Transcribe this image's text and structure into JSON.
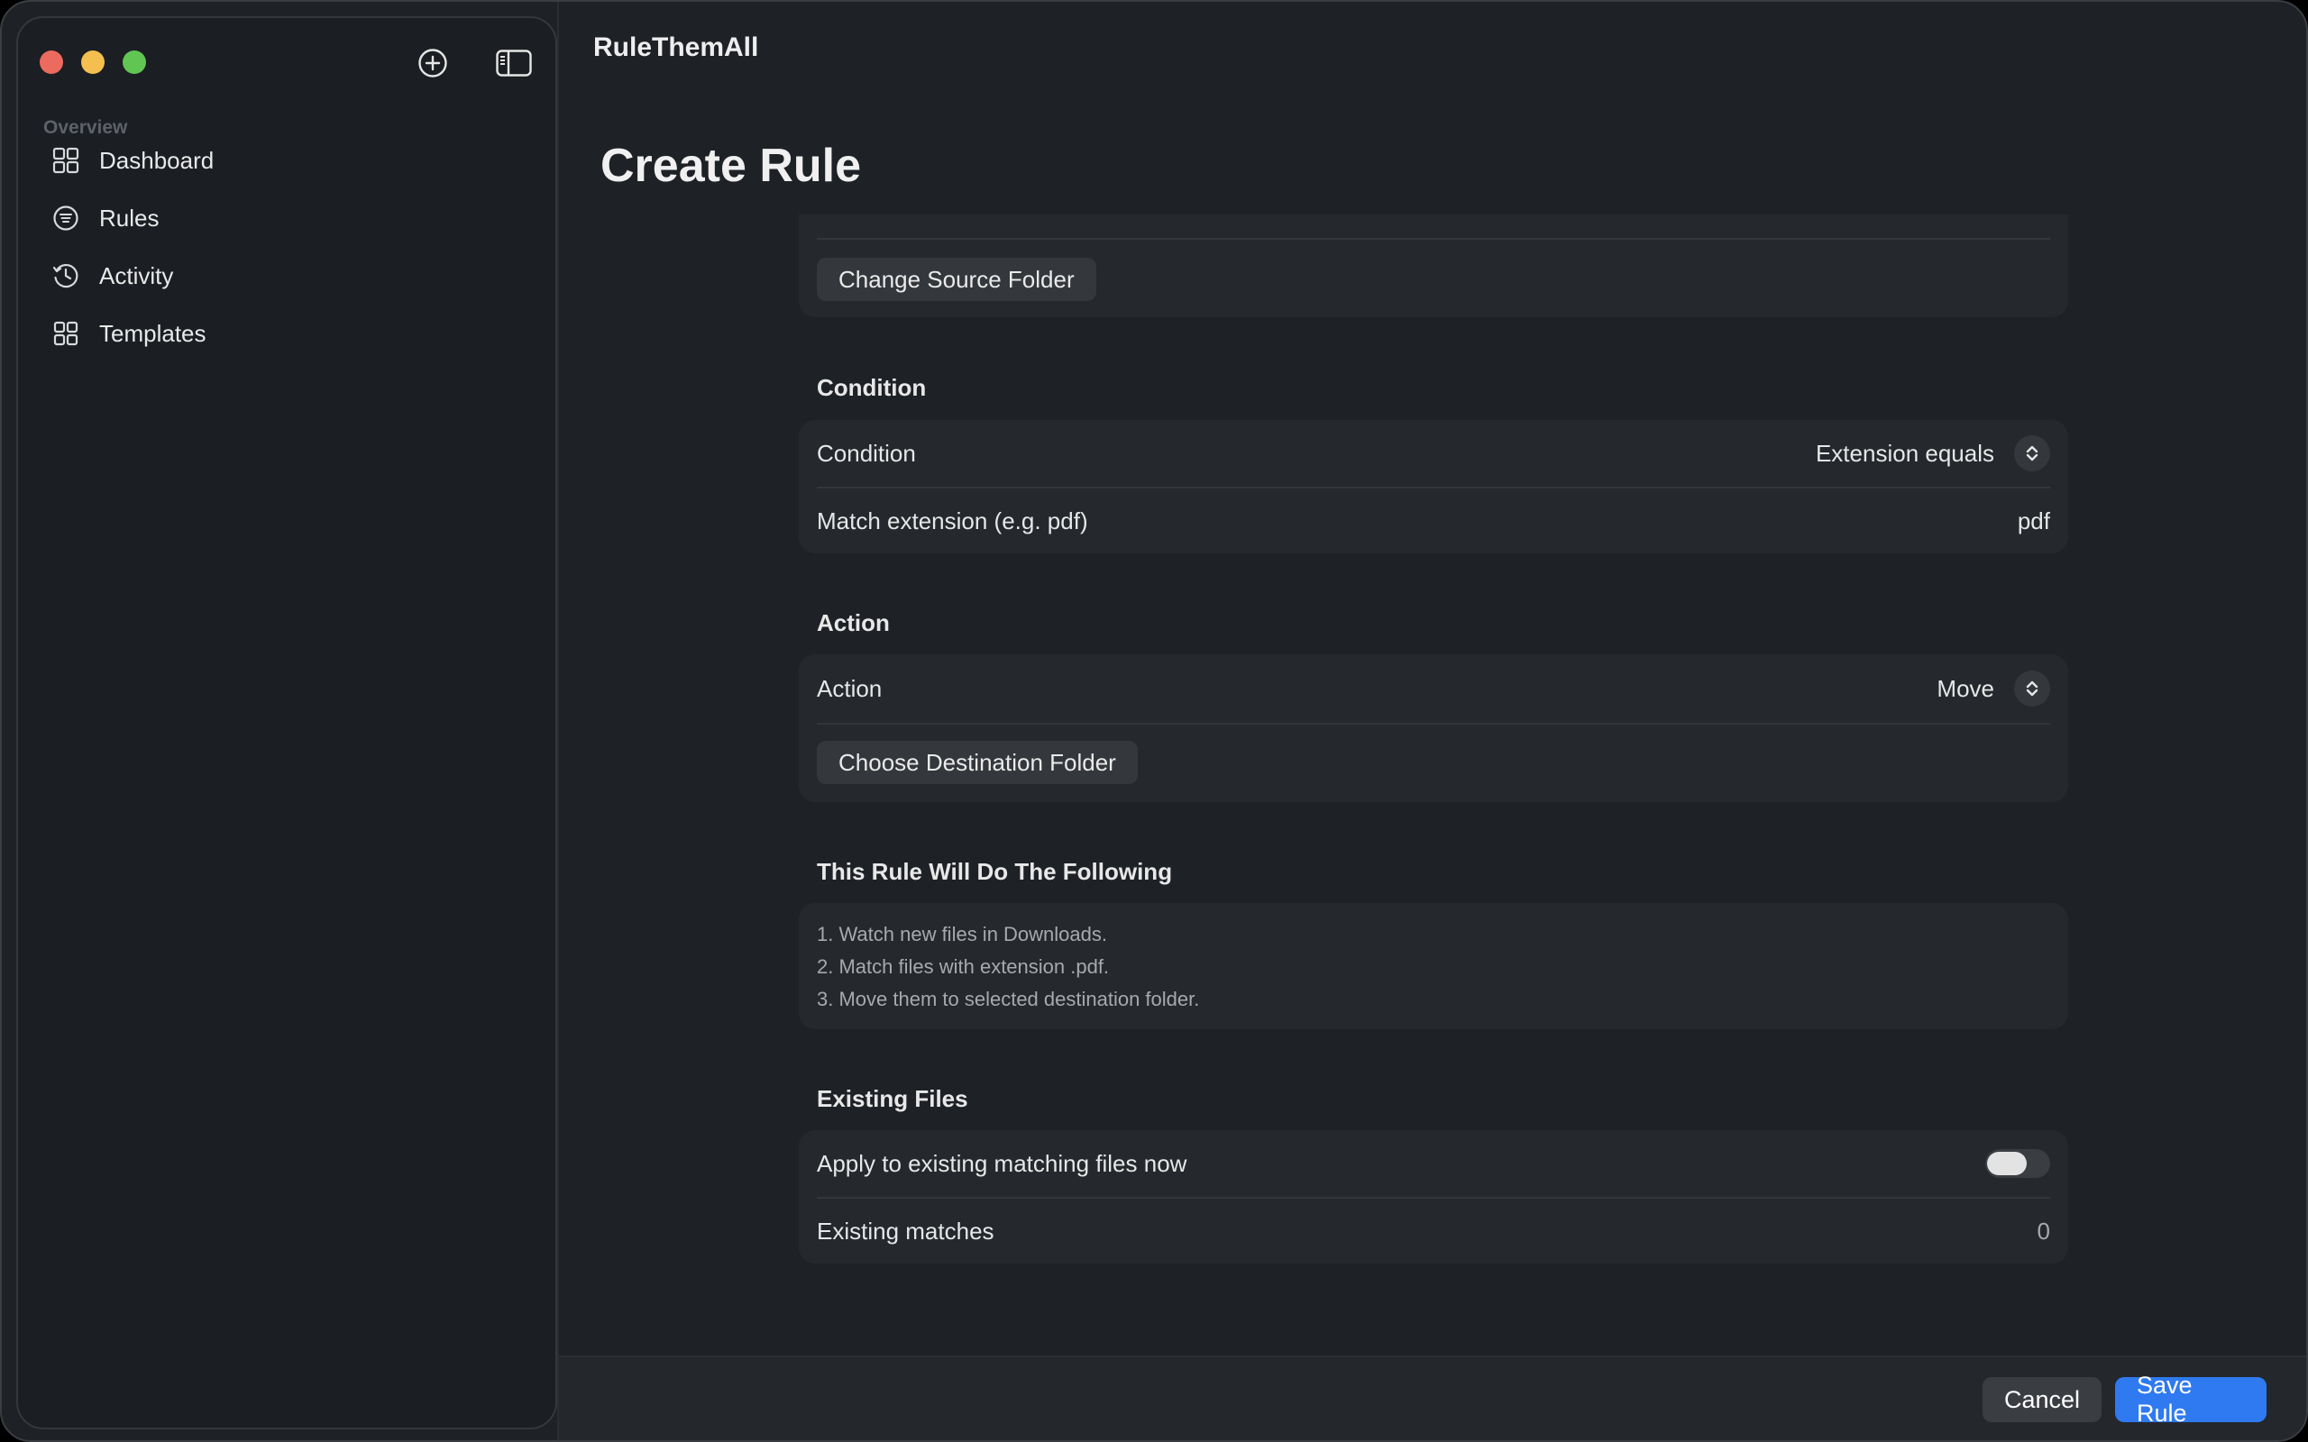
{
  "app": {
    "title": "RuleThemAll"
  },
  "sidebar": {
    "section": "Overview",
    "items": [
      {
        "label": "Dashboard",
        "icon": "grid-icon"
      },
      {
        "label": "Rules",
        "icon": "list-circle-icon"
      },
      {
        "label": "Activity",
        "icon": "history-clock-icon"
      },
      {
        "label": "Templates",
        "icon": "grid-icon"
      }
    ]
  },
  "page": {
    "title": "Create Rule"
  },
  "source": {
    "change_button": "Change Source Folder"
  },
  "condition": {
    "heading": "Condition",
    "condition_label": "Condition",
    "condition_value": "Extension equals",
    "match_label": "Match extension (e.g. pdf)",
    "match_value": "pdf"
  },
  "action": {
    "heading": "Action",
    "action_label": "Action",
    "action_value": "Move",
    "destination_button": "Choose Destination Folder"
  },
  "summary": {
    "heading": "This Rule Will Do The Following",
    "lines": [
      "1. Watch new files in Downloads.",
      "2. Match files with extension .pdf.",
      "3. Move them to selected destination folder."
    ]
  },
  "existing": {
    "heading": "Existing Files",
    "apply_label": "Apply to existing matching files now",
    "apply_enabled": false,
    "matches_label": "Existing matches",
    "matches_value": "0"
  },
  "footer": {
    "cancel": "Cancel",
    "save": "Save Rule"
  },
  "colors": {
    "accent": "#2f7af0",
    "close": "#ed6a5e",
    "minimize": "#f5bf4f",
    "zoom": "#61c554"
  }
}
